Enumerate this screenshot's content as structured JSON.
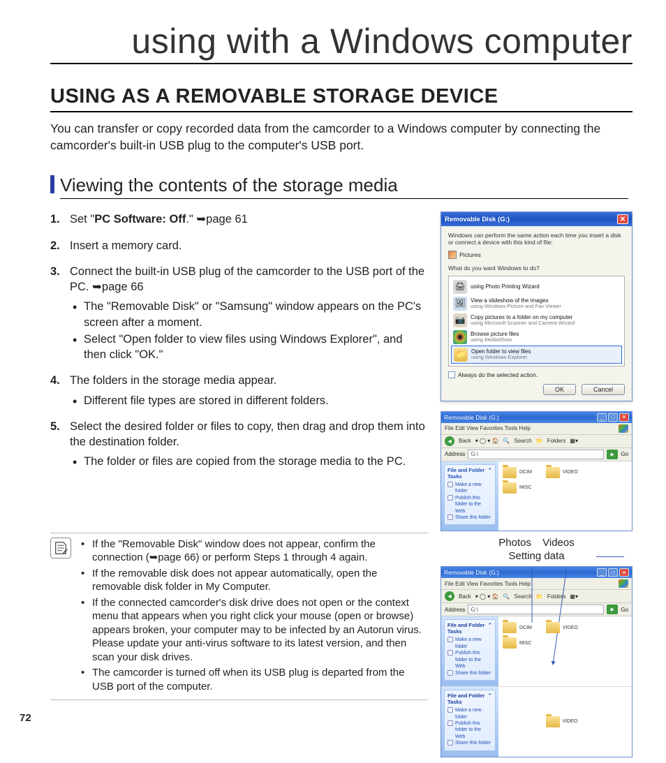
{
  "chapter_title": "using with a Windows computer",
  "section_title": "USING AS A REMOVABLE STORAGE DEVICE",
  "intro": "You can transfer or copy recorded data from the camcorder to a Windows computer by connecting the camcorder's built-in USB plug to the computer's USB port.",
  "subsection_title": "Viewing the contents of the storage media",
  "steps": {
    "s1": {
      "num": "1.",
      "text_pre": "Set \"",
      "bold": "PC Software: Off",
      "text_post": ".\" ",
      "ref": "➥page 61"
    },
    "s2": {
      "num": "2.",
      "text": "Insert a memory card."
    },
    "s3": {
      "num": "3.",
      "text": "Connect the built-in USB plug of the camcorder to the USB port of the PC. ",
      "ref": "➥page 66",
      "b1": "The \"Removable Disk\" or \"Samsung\" window appears on the PC's screen after a moment.",
      "b2": "Select \"Open folder to view files using Windows Explorer\", and then click \"OK.\""
    },
    "s4": {
      "num": "4.",
      "text": "The folders in the storage media appear.",
      "b1": "Different file types are stored in different folders."
    },
    "s5": {
      "num": "5.",
      "text": "Select the desired folder or files to copy, then drag and drop them into the destination folder.",
      "b1": "The folder or files are copied from the storage media to the PC."
    }
  },
  "notes": {
    "n1_a": "If the \"Removable Disk\" window does not appear, confirm the connection (",
    "n1_ref": "➥page 66",
    "n1_b": ") or perform Steps 1 through 4 again.",
    "n2": "If the removable disk does not appear automatically, open the removable disk folder in My Computer.",
    "n3": "If the connected camcorder's disk drive does not open or the context menu that appears when you right click your mouse (open or browse) appears broken, your computer may to be infected by an Autorun virus. Please update your anti-virus software to its latest version, and then scan your disk drives.",
    "n4": "The camcorder is turned off when its USB plug is departed from the USB port of the computer."
  },
  "page_number": "72",
  "dialog": {
    "title": "Removable Disk (G:)",
    "line1": "Windows can perform the same action each time you insert a disk or connect a device with this kind of file:",
    "file_type": "Pictures",
    "prompt": "What do you want Windows to do?",
    "actions": {
      "a1": {
        "p": "using Photo Printing Wizard",
        "s": ""
      },
      "a2": {
        "p": "View a slideshow of the images",
        "s": "using Windows Picture and Fax Viewer"
      },
      "a3": {
        "p": "Copy pictures to a folder on my computer",
        "s": "using Microsoft Scanner and Camera Wizard"
      },
      "a4": {
        "p": "Browse picture files",
        "s": "using MediaShow"
      },
      "a5": {
        "p": "Open folder to view files",
        "s": "using Windows Explorer"
      }
    },
    "always": "Always do the selected action.",
    "ok": "OK",
    "cancel": "Cancel"
  },
  "explorer": {
    "title": "Removable Disk (G:)",
    "menu": "File   Edit   View   Favorites   Tools   Help",
    "back": "Back",
    "search": "Search",
    "folders_btn": "Folders",
    "address_label": "Address",
    "address_value": "G:\\",
    "go": "Go",
    "task_title": "File and Folder Tasks",
    "task1": "Make a new folder",
    "task2": "Publish this folder to the Web",
    "task3": "Share this folder",
    "folders": {
      "f1": "DCIM",
      "f2": "VIDEO",
      "f3": "MISC"
    },
    "sub_folder": "VIDEO"
  },
  "labels": {
    "photos": "Photos",
    "videos": "Videos",
    "setting": "Setting data"
  }
}
